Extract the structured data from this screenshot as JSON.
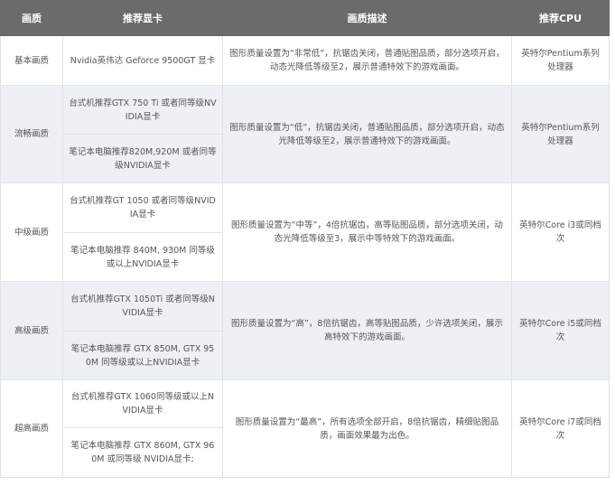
{
  "table": {
    "headers": [
      "画质",
      "推荐显卡",
      "画质描述",
      "推荐CPU"
    ],
    "rows": [
      {
        "quality": "基本画质",
        "gpus": [
          "Nvidia英伟达 Geforce 9500GT 显卡"
        ],
        "description": "图形质量设置为“非常低”，抗锯齿关闭，普通贴图品质，部分选项开启，动态光降低等级至2，展示普通特效下的游戏画面。",
        "cpu": "英特尔Pentium系列处理器"
      },
      {
        "quality": "流畅画质",
        "gpus": [
          "台式机推荐GTX 750 Ti 或者同等级NVIDIA显卡",
          "笔记本电脑推荐820M,920M 或者同等级NVIDIA显卡"
        ],
        "description": "图形质量设置为“低”，抗锯齿关闭，普通贴图品质，部分选项开启，动态光降低等级至2，展示普通特效下的游戏画面。",
        "cpu": "英特尔Pentium系列处理器"
      },
      {
        "quality": "中级画质",
        "gpus": [
          "台式机推荐GT 1050 或者同等级NVIDIA显卡",
          "笔记本电脑推荐 840M, 930M 同等级或以上NVIDIA显卡"
        ],
        "description": "图形质量设置为“中等”，4倍抗锯齿，高等贴图品质，部分选项关闭，动态光降低等级至3，展示中等特效下的游戏画面。",
        "cpu": "英特尔Core i3或同档次"
      },
      {
        "quality": "高级画质",
        "gpus": [
          "台式机推荐GTX 1050Ti 或者同等级NVIDIA显卡",
          "笔记本电脑推荐 GTX 850M, GTX 950M 同等级或以上NVIDIA显卡"
        ],
        "description": "图形质量设置为“高”，8倍抗锯齿，高等贴图品质，少许选项关闭，展示高特效下的游戏画面。",
        "cpu": "英特尔Core i5或同档次"
      },
      {
        "quality": "超高画质",
        "gpus": [
          "台式机推荐GTX 1060同等级或以上NVIDIA显卡",
          "笔记本电脑推荐 GTX 860M, GTX 960M 或同等级 NVIDIA显卡;"
        ],
        "description": "图形质量设置为“最高”，所有选项全部开启，8倍抗锯齿，精细贴图品质，画面效果最为出色。",
        "cpu": "英特尔Core i7或同档次"
      }
    ]
  }
}
